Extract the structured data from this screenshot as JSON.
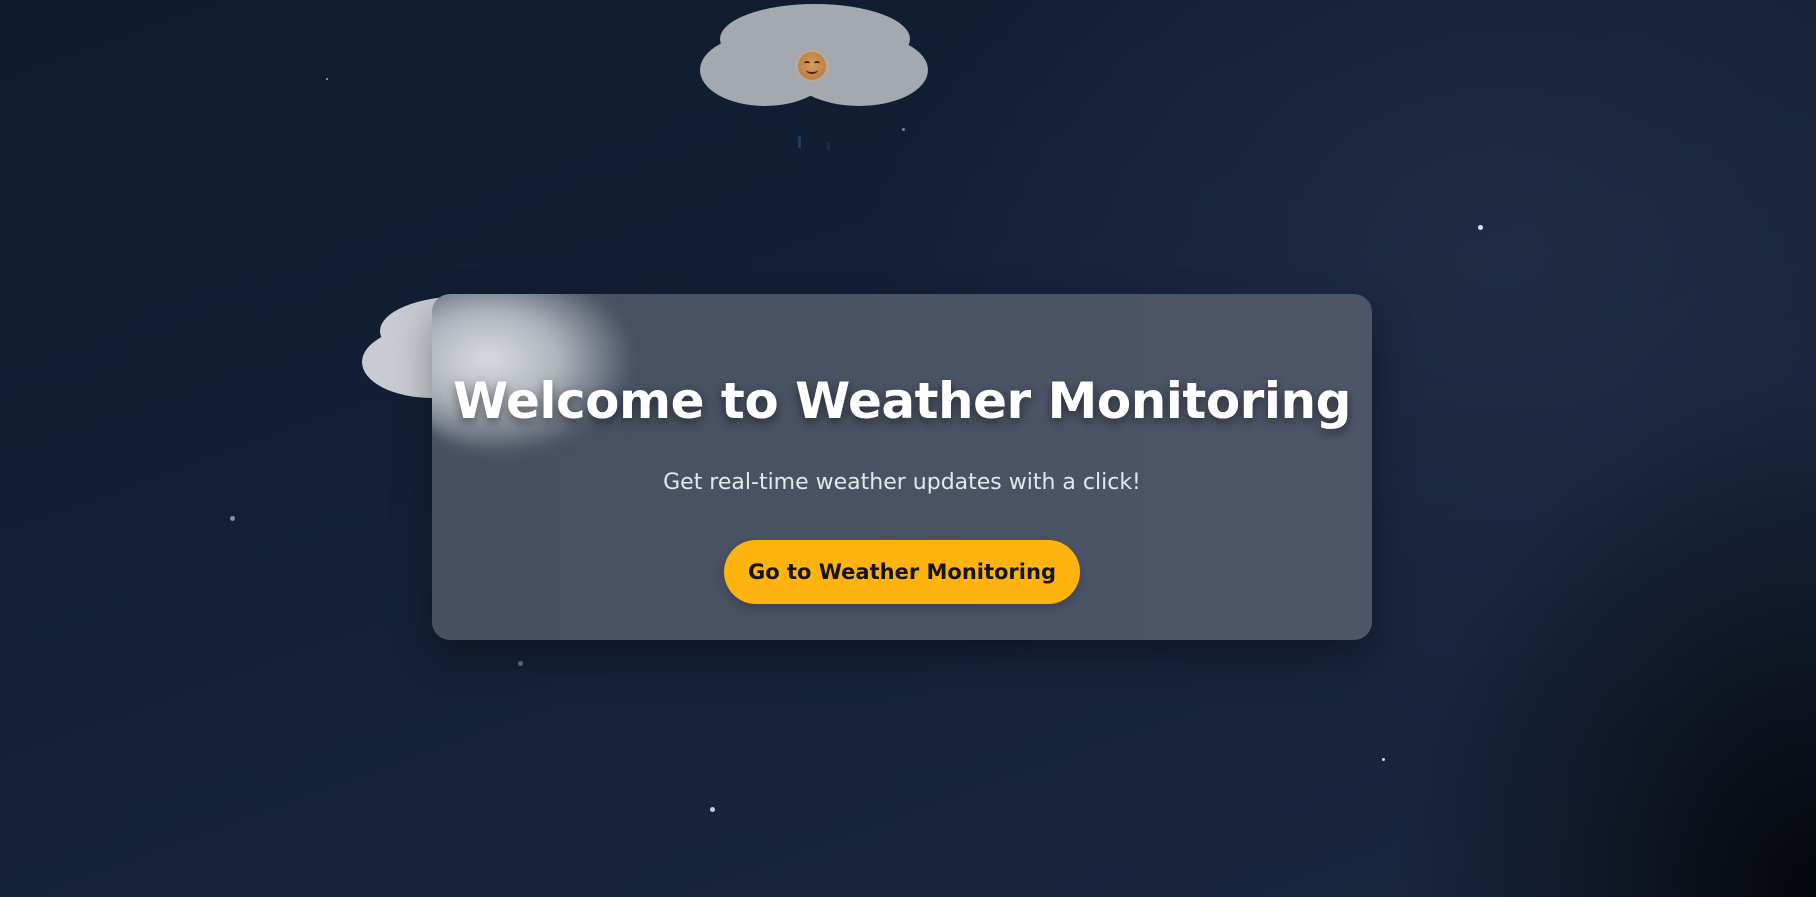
{
  "hero": {
    "title": "Welcome to Weather Monitoring",
    "subtitle": "Get real-time weather updates with a click!",
    "cta_label": "Go to Weather Monitoring"
  },
  "icons": {
    "cloud_face": "smiling-face-icon",
    "cloud": "cloud-icon",
    "star": "star-icon"
  },
  "colors": {
    "background": "#132036",
    "card": "#4a5364",
    "accent": "#ffb30f",
    "title_text": "#ffffff",
    "subtitle_text": "#e4e7ec",
    "button_text": "#141414"
  }
}
